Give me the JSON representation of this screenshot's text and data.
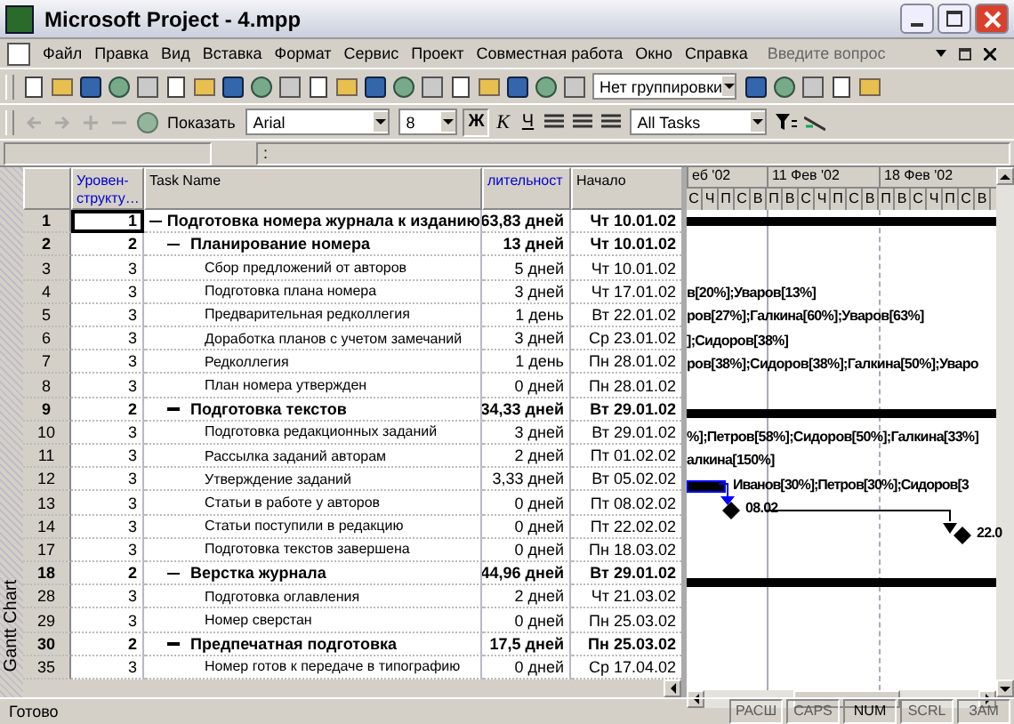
{
  "window": {
    "title": "Microsoft Project - 4.mpp"
  },
  "menu": [
    "Файл",
    "Правка",
    "Вид",
    "Вставка",
    "Формат",
    "Сервис",
    "Проект",
    "Совместная работа",
    "Окно",
    "Справка"
  ],
  "help_search": {
    "placeholder": "Введите вопрос"
  },
  "toolbar_standard": {
    "grouping": "Нет группировки"
  },
  "toolbar_formatting": {
    "show": "Показать",
    "font": "Arial",
    "size": "8",
    "bold": "Ж",
    "italic": "К",
    "underline": "Ч",
    "filter": "All Tasks"
  },
  "entry_bar": {
    "text": ":"
  },
  "view_bar": {
    "label": "Gantt Chart"
  },
  "table": {
    "columns": [
      "Уровен- структу…",
      "Task Name",
      "лительност",
      "Начало"
    ],
    "rows": [
      {
        "id": "1",
        "level": "1",
        "name": "Подготовка номера журнала к изданию",
        "duration": "63,83 дней",
        "start": "Чт 10.01.02",
        "selected": true,
        "expanded": true,
        "gantt": {
          "kind": "summary"
        },
        "children": [
          {
            "id": "2",
            "level": "2",
            "name": "Планирование номера",
            "duration": "13 дней",
            "start": "Чт 10.01.02",
            "selected": false,
            "expanded": true,
            "children": [
              {
                "id": "3",
                "level": "3",
                "name": "Сбор предложений от авторов",
                "duration": "5 дней",
                "start": "Чт 10.01.02",
                "selected": false
              },
              {
                "id": "4",
                "level": "3",
                "name": "Подготовка плана номера",
                "duration": "3 дней",
                "start": "Чт 17.01.02",
                "selected": false,
                "gantt": {
                  "kind": "label",
                  "text": "в[20%];Уваров[13%]"
                }
              },
              {
                "id": "5",
                "level": "3",
                "name": "Предварительная редколлегия",
                "duration": "1 день",
                "start": "Вт 22.01.02",
                "selected": false,
                "gantt": {
                  "kind": "label",
                  "text": "ров[27%];Галкина[60%];Уваров[63%]"
                }
              },
              {
                "id": "6",
                "level": "3",
                "name": "Доработка планов с учетом замечаний",
                "duration": "3 дней",
                "start": "Ср 23.01.02",
                "selected": false,
                "gantt": {
                  "kind": "label",
                  "text": "];Сидоров[38%]"
                }
              },
              {
                "id": "7",
                "level": "3",
                "name": "Редколлегия",
                "duration": "1 день",
                "start": "Пн 28.01.02",
                "selected": false,
                "gantt": {
                  "kind": "label",
                  "text": "ров[38%];Сидоров[38%];Галкина[50%];Уваро"
                }
              },
              {
                "id": "8",
                "level": "3",
                "name": "План номера утвержден",
                "duration": "0 дней",
                "start": "Пн 28.01.02",
                "selected": false
              }
            ]
          },
          {
            "id": "9",
            "level": "2",
            "name": "Подготовка текстов",
            "duration": "34,33 дней",
            "start": "Вт 29.01.02",
            "selected": false,
            "expanded": true,
            "gantt": {
              "kind": "summary"
            },
            "children": [
              {
                "id": "10",
                "level": "3",
                "name": "Подготовка редакционных заданий",
                "duration": "3 дней",
                "start": "Вт 29.01.02",
                "selected": false,
                "gantt": {
                  "kind": "label",
                  "text": "%];Петров[58%];Сидоров[50%];Галкина[33%]"
                }
              },
              {
                "id": "11",
                "level": "3",
                "name": "Рассылка заданий авторам",
                "duration": "2 дней",
                "start": "Пт 01.02.02",
                "selected": false,
                "gantt": {
                  "kind": "label",
                  "text": "алкина[150%]"
                }
              },
              {
                "id": "12",
                "level": "3",
                "name": "Утверждение заданий",
                "duration": "3,33 дней",
                "start": "Вт 05.02.02",
                "selected": false,
                "gantt": {
                  "kind": "task",
                  "text": "Иванов[30%];Петров[30%];Сидоров[3"
                }
              },
              {
                "id": "13",
                "level": "3",
                "name": "Статьи в работе у авторов",
                "duration": "0 дней",
                "start": "Пт 08.02.02",
                "selected": false,
                "gantt": {
                  "kind": "milestone",
                  "text": "08.02"
                }
              },
              {
                "id": "14",
                "level": "3",
                "name": "Статьи поступили в редакцию",
                "duration": "0 дней",
                "start": "Пт 22.02.02",
                "selected": false,
                "gantt": {
                  "kind": "milestone",
                  "text": "22.0"
                }
              },
              {
                "id": "17",
                "level": "3",
                "name": "Подготовка текстов завершена",
                "duration": "0 дней",
                "start": "Пн 18.03.02",
                "selected": false
              }
            ]
          },
          {
            "id": "18",
            "level": "2",
            "name": "Верстка журнала",
            "duration": "44,96 дней",
            "start": "Вт 29.01.02",
            "selected": false,
            "expanded": true,
            "gantt": {
              "kind": "summary"
            },
            "children": [
              {
                "id": "28",
                "level": "3",
                "name": "Подготовка оглавления",
                "duration": "2 дней",
                "start": "Чт 21.03.02",
                "selected": false
              },
              {
                "id": "29",
                "level": "3",
                "name": "Номер сверстан",
                "duration": "0 дней",
                "start": "Пн 25.03.02",
                "selected": false
              }
            ]
          },
          {
            "id": "30",
            "level": "2",
            "name": "Предпечатная подготовка",
            "duration": "17,5 дней",
            "start": "Пн 25.03.02",
            "selected": false,
            "expanded": true,
            "children": [
              {
                "id": "35",
                "level": "3",
                "name": "Номер готов к передаче в типографию",
                "duration": "0 дней",
                "start": "Ср 17.04.02",
                "selected": false
              }
            ]
          }
        ]
      }
    ]
  },
  "timescale": {
    "weeks": [
      "еб '02",
      "11 Фев '02",
      "18 Фев '02"
    ],
    "days": [
      "С",
      "Ч",
      "П",
      "С",
      "В",
      "П",
      "В",
      "С",
      "Ч",
      "П",
      "С",
      "В",
      "П",
      "В",
      "С",
      "Ч",
      "П",
      "С",
      "В"
    ]
  },
  "status_bar": {
    "text": "Готово",
    "indicators": [
      {
        "label": "РАСШ",
        "on": false
      },
      {
        "label": "CAPS",
        "on": false
      },
      {
        "label": "NUM",
        "on": true
      },
      {
        "label": "SCRL",
        "on": false
      },
      {
        "label": "ЗАМ",
        "on": false
      }
    ]
  }
}
